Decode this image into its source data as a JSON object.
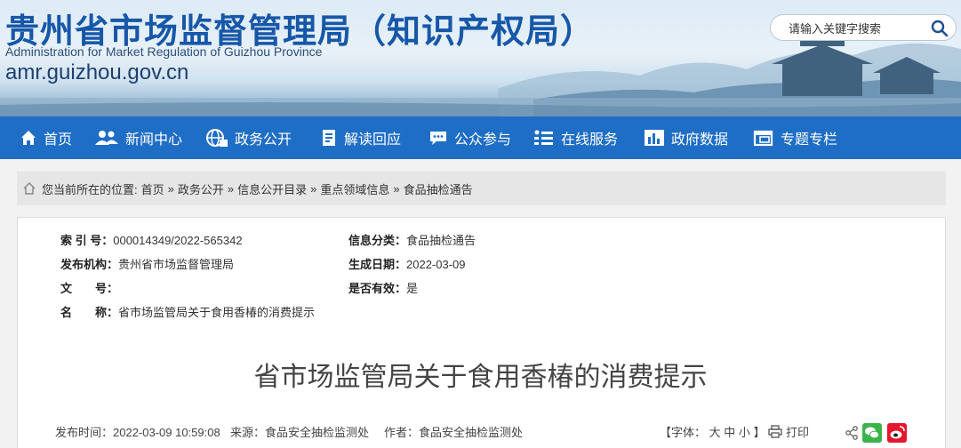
{
  "header": {
    "title": "贵州省市场监督管理局（知识产权局）",
    "subtitle_en": "Administration for Market Regulation of Guizhou Province",
    "domain": "amr.guizhou.gov.cn",
    "search_placeholder": "请输入关键字搜索"
  },
  "nav": {
    "items": [
      {
        "label": "首页",
        "icon": "home-icon"
      },
      {
        "label": "新闻中心",
        "icon": "people-icon"
      },
      {
        "label": "政务公开",
        "icon": "globe-icon"
      },
      {
        "label": "解读回应",
        "icon": "document-icon"
      },
      {
        "label": "公众参与",
        "icon": "chat-icon"
      },
      {
        "label": "在线服务",
        "icon": "list-icon"
      },
      {
        "label": "政府数据",
        "icon": "bar-chart-icon"
      },
      {
        "label": "专题专栏",
        "icon": "window-icon"
      }
    ]
  },
  "breadcrumb": {
    "prefix": "您当前所在的位置:",
    "items": [
      "首页",
      "政务公开",
      "信息公开目录",
      "重点领域信息",
      "食品抽检通告"
    ],
    "separator": "»"
  },
  "meta": {
    "index_label": "索 引 号：",
    "index_value": "000014349/2022-565342",
    "category_label": "信息分类：",
    "category_value": "食品抽检通告",
    "publisher_label": "发布机构：",
    "publisher_value": "贵州省市场监督管理局",
    "date_label": "生成日期：",
    "date_value": "2022-03-09",
    "docno_label": "文　　号：",
    "docno_value": "",
    "valid_label": "是否有效：",
    "valid_value": "是",
    "name_label": "名　　称：",
    "name_value": "省市场监管局关于食用香椿的消费提示"
  },
  "article": {
    "title": "省市场监管局关于食用香椿的消费提示",
    "publish_time": "发布时间：2022-03-09 10:59:08",
    "source": "来源：食品安全抽检监测处",
    "author": "作者：食品安全抽检监测处",
    "font_prefix": "【字体：",
    "font_large": "大",
    "font_medium": "中",
    "font_small": "小",
    "font_suffix": "】",
    "print_label": "打印"
  },
  "colors": {
    "nav_bg": "#1f6ec5",
    "title_blue": "#1757a8",
    "wechat_green": "#3bb34a",
    "weibo_red": "#e6162d"
  }
}
